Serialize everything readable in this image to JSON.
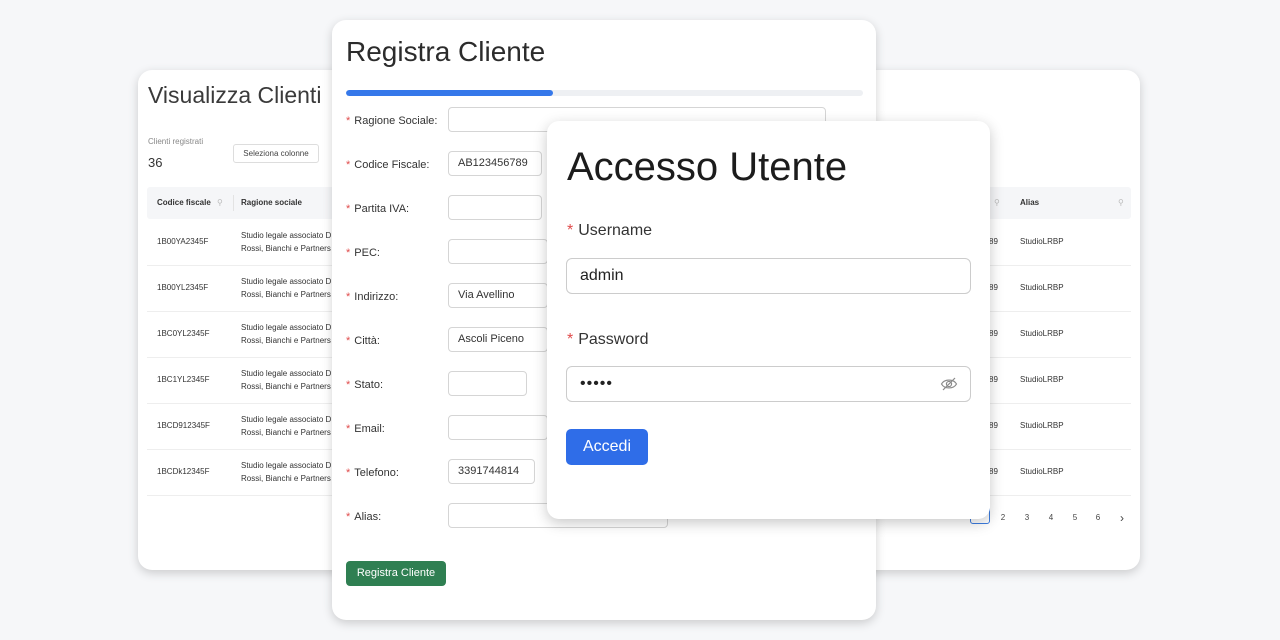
{
  "clients": {
    "title": "Visualizza Clienti",
    "registered_label": "Clienti registrati",
    "registered_count": "36",
    "select_columns_label": "Seleziona colonne",
    "columns": {
      "codice_fiscale": "Codice fiscale",
      "ragione_sociale": "Ragione sociale",
      "alias": "Alias"
    },
    "rows": [
      {
        "cf": "1B00YA2345F",
        "rs1": "Studio legale associato D",
        "rs2": "Rossi, Bianchi e Partners",
        "num": "89",
        "alias": "StudioLRBP"
      },
      {
        "cf": "1B00YL2345F",
        "rs1": "Studio legale associato D",
        "rs2": "Rossi, Bianchi e Partners",
        "num": "89",
        "alias": "StudioLRBP"
      },
      {
        "cf": "1BC0YL2345F",
        "rs1": "Studio legale associato D",
        "rs2": "Rossi, Bianchi e Partners",
        "num": "89",
        "alias": "StudioLRBP"
      },
      {
        "cf": "1BC1YL2345F",
        "rs1": "Studio legale associato D",
        "rs2": "Rossi, Bianchi e Partners",
        "num": "89",
        "alias": "StudioLRBP"
      },
      {
        "cf": "1BCD912345F",
        "rs1": "Studio legale associato D",
        "rs2": "Rossi, Bianchi e Partners",
        "num": "89",
        "alias": "StudioLRBP"
      },
      {
        "cf": "1BCDk12345F",
        "rs1": "Studio legale associato D",
        "rs2": "Rossi, Bianchi e Partners",
        "num": "89",
        "alias": "StudioLRBP"
      }
    ],
    "pagination": [
      "2",
      "3",
      "4",
      "5",
      "6"
    ],
    "next_glyph": "›"
  },
  "register": {
    "title": "Registra Cliente",
    "progress": 0.4,
    "fields": [
      {
        "label": "Ragione Sociale",
        "value": ""
      },
      {
        "label": "Codice Fiscale",
        "value": "AB123456789"
      },
      {
        "label": "Partita IVA",
        "value": ""
      },
      {
        "label": "PEC",
        "value": ""
      },
      {
        "label": "Indirizzo",
        "value": "Via Avellino"
      },
      {
        "label": "Città",
        "value": "Ascoli Piceno"
      },
      {
        "label": "Stato",
        "value": ""
      },
      {
        "label": "Email",
        "value": ""
      },
      {
        "label": "Telefono",
        "value": "3391744814"
      },
      {
        "label": "Alias",
        "value": ""
      }
    ],
    "submit_label": "Registra Cliente"
  },
  "login": {
    "title": "Accesso Utente",
    "username_label": "Username",
    "username_value": "admin",
    "password_label": "Password",
    "password_value": "•••••",
    "submit_label": "Accedi"
  },
  "colors": {
    "primary": "#2f6de8",
    "progress": "#3578ea",
    "success": "#2f7f52",
    "required": "#e04b4b"
  },
  "icons": {
    "column_search": "search-icon",
    "password_toggle": "eye-slash-icon",
    "next_page": "chevron-right-icon"
  }
}
